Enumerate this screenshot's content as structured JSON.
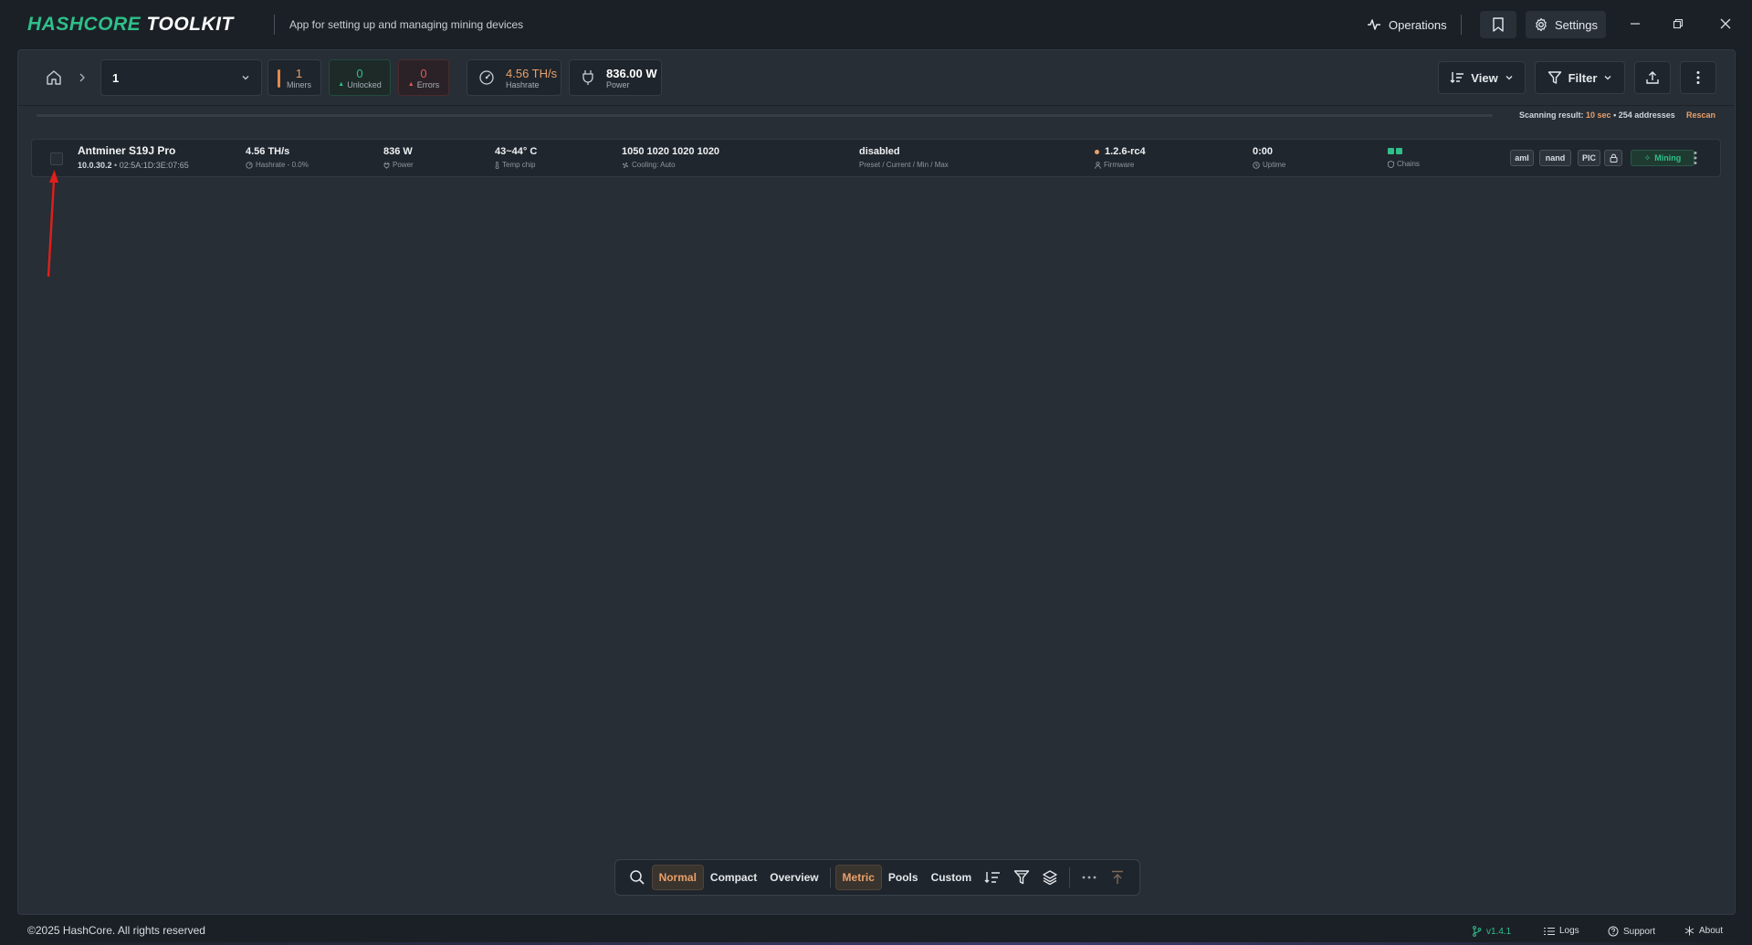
{
  "app": {
    "logo_brand": "HASHCORE",
    "logo_rest": "TOOLKIT",
    "subtitle": "App for setting up and managing mining devices"
  },
  "titlebar": {
    "operations_label": "Operations",
    "settings_label": "Settings"
  },
  "toolbar": {
    "group_selected": "1",
    "stats": {
      "miners_value": "1",
      "miners_label": "Miners",
      "unlocked_value": "0",
      "unlocked_label": "Unlocked",
      "errors_value": "0",
      "errors_label": "Errors",
      "hashrate_value": "4.56 TH/s",
      "hashrate_label": "Hashrate",
      "power_value": "836.00 W",
      "power_label": "Power"
    },
    "view_label": "View",
    "filter_label": "Filter"
  },
  "scan": {
    "prefix": "Scanning result:",
    "time": "10 sec",
    "bullet": " • ",
    "addresses": "254 addresses",
    "rescan_label": "Rescan"
  },
  "miner": {
    "model": "Antminer S19J Pro",
    "ip": "10.0.30.2",
    "mac": " • 02:5A:1D:3E:07:65",
    "hashrate": "4.56 TH/s",
    "hashrate_sub": "Hashrate - 0.0%",
    "power": "836 W",
    "power_sub": "Power",
    "temp": "43~44° C",
    "temp_sub": "Temp chip",
    "fans": "1050 1020 1020 1020",
    "fans_sub": "Cooling: Auto",
    "preset": "disabled",
    "preset_sub": "Preset / Current / Min / Max",
    "firmware": "1.2.6-rc4",
    "firmware_sub": "Firmware",
    "uptime": "0:00",
    "uptime_sub": "Uptime",
    "chains_sub": "Chains",
    "tags": [
      "aml",
      "nand",
      "PIC"
    ],
    "status": "Mining"
  },
  "bottombar": {
    "normal": "Normal",
    "compact": "Compact",
    "overview": "Overview",
    "metric": "Metric",
    "pools": "Pools",
    "custom": "Custom"
  },
  "footer": {
    "copyright": "©2025 HashCore. All rights reserved",
    "version": "v1.4.1",
    "logs": "Logs",
    "support": "Support",
    "about": "About"
  },
  "colors": {
    "accent_orange": "#e9a06a",
    "accent_green": "#2fbf8a",
    "error_red": "#e05a5a",
    "background": "#1b2026",
    "panel": "#272e36",
    "annotation_arrow": "#e0201a"
  },
  "icons": [
    "operations-icon",
    "bookmark-icon",
    "gear-icon",
    "minimize-icon",
    "restore-icon",
    "close-icon",
    "home-icon",
    "chevron-right-icon",
    "chevron-down-icon",
    "speedometer-icon",
    "plug-icon",
    "sort-list-icon",
    "filter-icon",
    "upload-icon",
    "kebab-icon",
    "lock-icon",
    "search-icon",
    "layers-icon",
    "more-icon",
    "scroll-top-icon",
    "branch-icon",
    "list-icon",
    "help-circle-icon",
    "asterisk-icon"
  ]
}
